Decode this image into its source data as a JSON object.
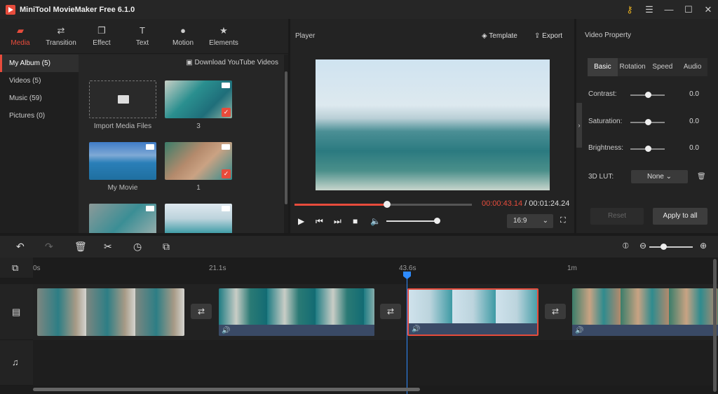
{
  "app": {
    "title": "MiniTool MovieMaker Free 6.1.0"
  },
  "colors": {
    "accent": "#e74c3c",
    "playhead": "#2e8bff"
  },
  "media_tabs": [
    {
      "label": "Media",
      "icon": "folder-icon",
      "active": true
    },
    {
      "label": "Transition",
      "icon": "transition-icon"
    },
    {
      "label": "Effect",
      "icon": "effect-icon"
    },
    {
      "label": "Text",
      "icon": "text-icon"
    },
    {
      "label": "Motion",
      "icon": "motion-icon"
    },
    {
      "label": "Elements",
      "icon": "elements-icon"
    }
  ],
  "library": {
    "items": [
      {
        "label": "My Album (5)",
        "active": true
      },
      {
        "label": "Videos (5)"
      },
      {
        "label": "Music (59)"
      },
      {
        "label": "Pictures (0)"
      }
    ],
    "download_label": "Download YouTube Videos",
    "thumbs": [
      "Import Media Files",
      "3",
      "My Movie",
      "1"
    ]
  },
  "player": {
    "title": "Player",
    "template_label": "Template",
    "export_label": "Export",
    "current_time": "00:00:43.14",
    "total_time": "/ 00:01:24.24",
    "progress": 0.52,
    "aspect": "16:9"
  },
  "properties": {
    "title": "Video Property",
    "tabs": [
      "Basic",
      "Rotation",
      "Speed",
      "Audio"
    ],
    "rows": [
      {
        "label": "Contrast:",
        "value": "0.0"
      },
      {
        "label": "Saturation:",
        "value": "0.0"
      },
      {
        "label": "Brightness:",
        "value": "0.0"
      }
    ],
    "lut_label": "3D LUT:",
    "lut_value": "None",
    "reset_label": "Reset",
    "apply_label": "Apply to all"
  },
  "timeline": {
    "ruler": [
      "0s",
      "21.1s",
      "43.6s",
      "1m"
    ]
  }
}
